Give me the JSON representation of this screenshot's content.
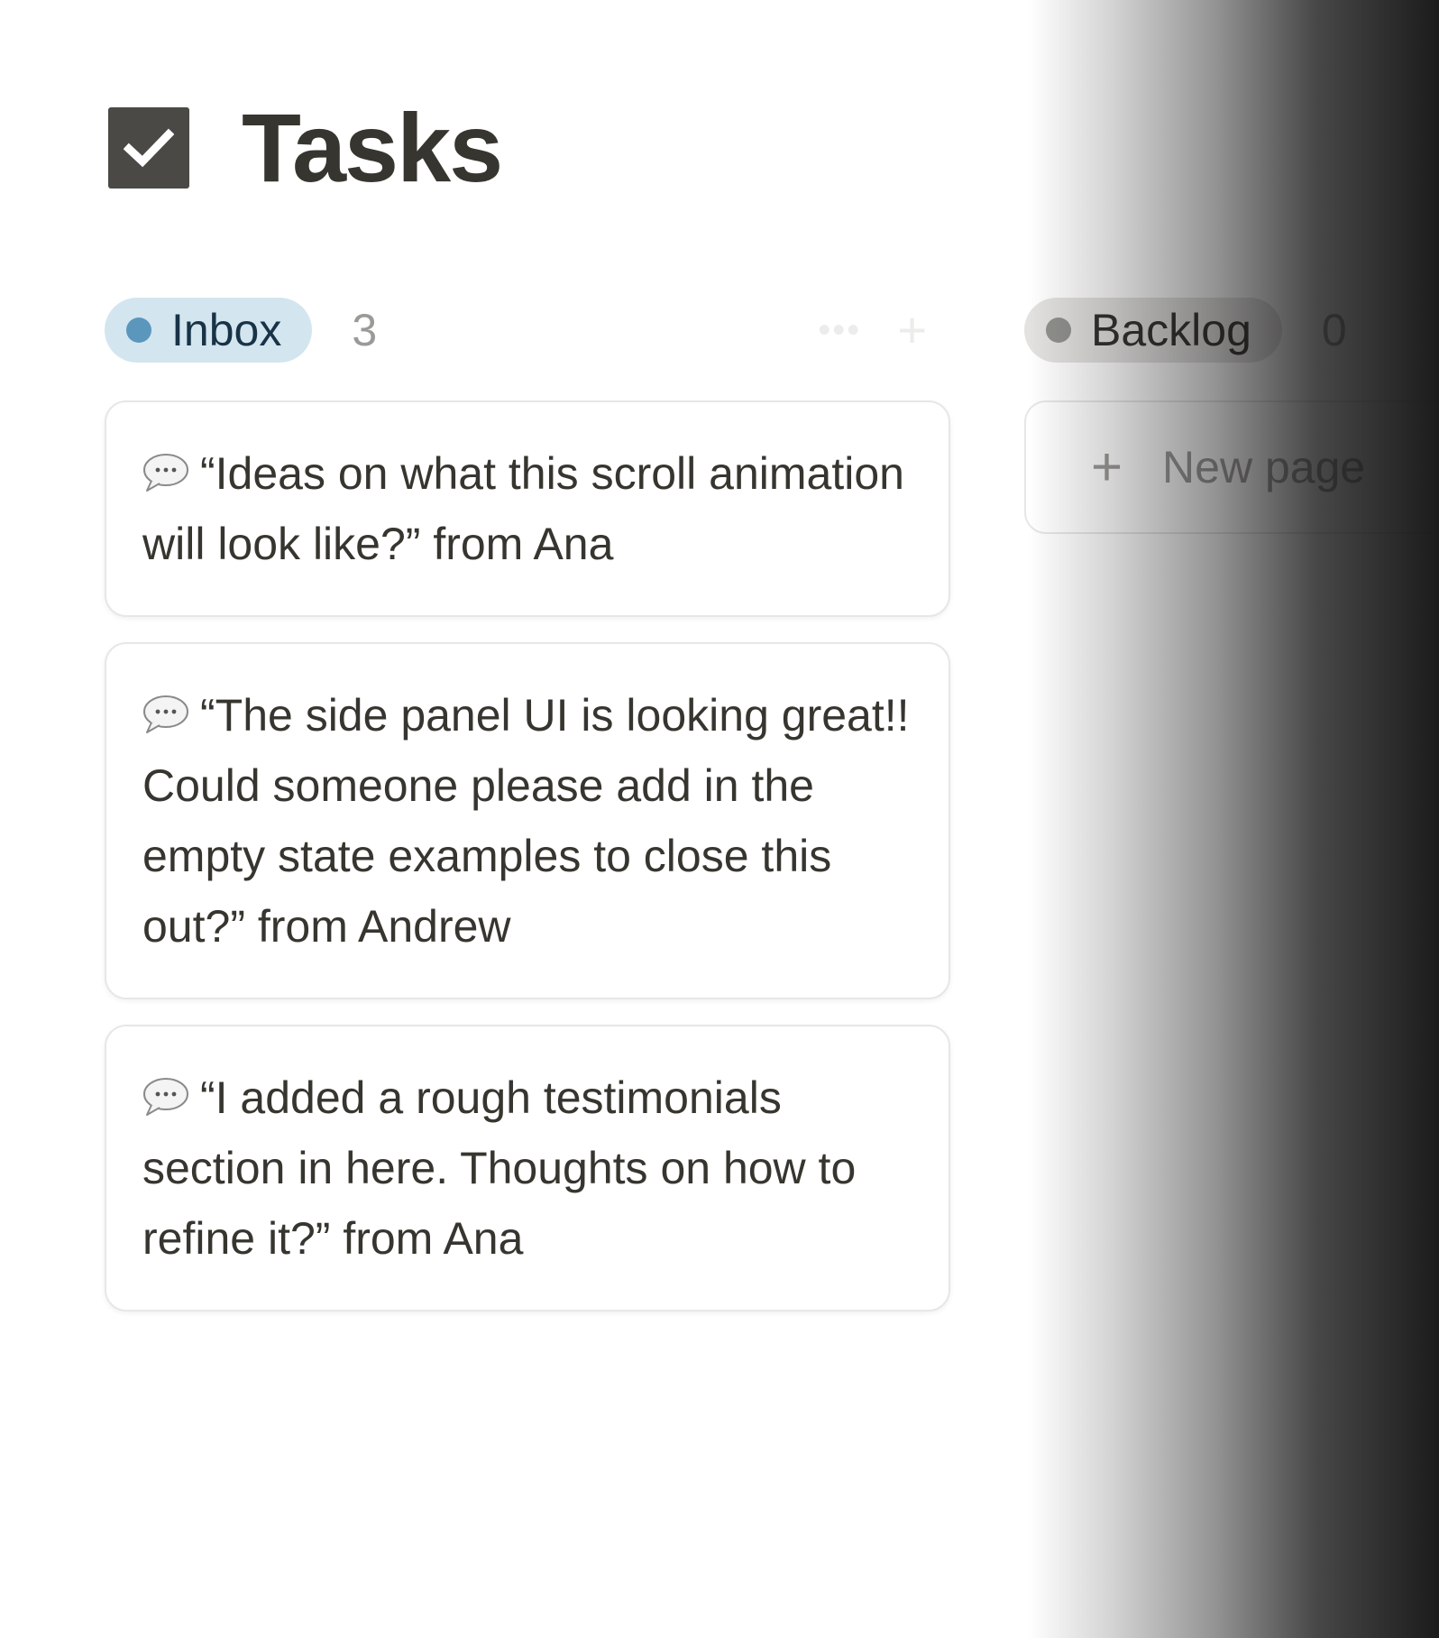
{
  "page": {
    "title": "Tasks"
  },
  "board": {
    "columns": [
      {
        "name": "Inbox",
        "count": "3",
        "color": "#5b97bd",
        "cards": [
          {
            "icon": "speech-bubble-icon",
            "text": "“Ideas on what this scroll animation will look like?” from Ana"
          },
          {
            "icon": "speech-bubble-icon",
            "text": "“The side panel UI is looking great!! Could someone please add in the empty state examples to close this out?” from Andrew"
          },
          {
            "icon": "speech-bubble-icon",
            "text": "“I added a rough testimonials section in here. Thoughts on how to refine it?” from Ana"
          }
        ]
      },
      {
        "name": "Backlog",
        "count": "0",
        "color": "#91918e",
        "new_page_label": "New page"
      }
    ]
  },
  "colors": {
    "inbox_pill_bg": "#d3e5ef",
    "backlog_pill_bg": "#e3e2e0",
    "text": "#37352f",
    "muted": "#9b9a97"
  }
}
